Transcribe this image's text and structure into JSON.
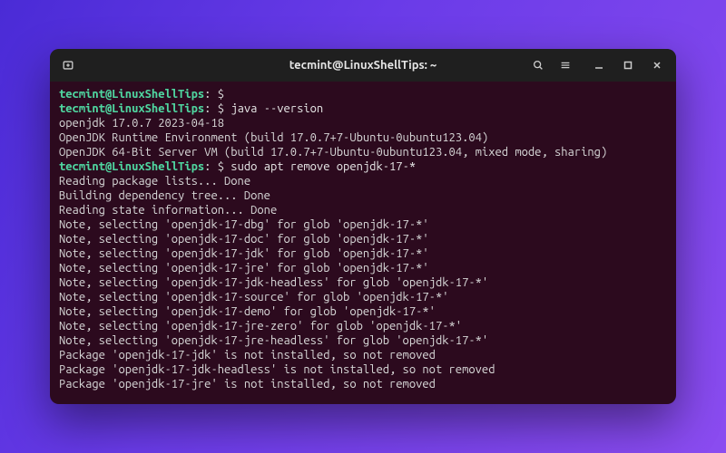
{
  "window": {
    "title": "tecmint@LinuxShellTips: ~"
  },
  "prompt": {
    "user_host": "tecmint@LinuxShellTips",
    "sep": ":",
    "path_sym": " $ "
  },
  "session": [
    {
      "type": "prompt",
      "cmd": ""
    },
    {
      "type": "prompt",
      "cmd": "java --version"
    },
    {
      "type": "out",
      "text": "openjdk 17.0.7 2023-04-18"
    },
    {
      "type": "out",
      "text": "OpenJDK Runtime Environment (build 17.0.7+7-Ubuntu-0ubuntu123.04)"
    },
    {
      "type": "out",
      "text": "OpenJDK 64-Bit Server VM (build 17.0.7+7-Ubuntu-0ubuntu123.04, mixed mode, sharing)"
    },
    {
      "type": "prompt",
      "cmd": "sudo apt remove openjdk-17-*"
    },
    {
      "type": "out",
      "text": "Reading package lists... Done"
    },
    {
      "type": "out",
      "text": "Building dependency tree... Done"
    },
    {
      "type": "out",
      "text": "Reading state information... Done"
    },
    {
      "type": "out",
      "text": "Note, selecting 'openjdk-17-dbg' for glob 'openjdk-17-*'"
    },
    {
      "type": "out",
      "text": "Note, selecting 'openjdk-17-doc' for glob 'openjdk-17-*'"
    },
    {
      "type": "out",
      "text": "Note, selecting 'openjdk-17-jdk' for glob 'openjdk-17-*'"
    },
    {
      "type": "out",
      "text": "Note, selecting 'openjdk-17-jre' for glob 'openjdk-17-*'"
    },
    {
      "type": "out",
      "text": "Note, selecting 'openjdk-17-jdk-headless' for glob 'openjdk-17-*'"
    },
    {
      "type": "out",
      "text": "Note, selecting 'openjdk-17-source' for glob 'openjdk-17-*'"
    },
    {
      "type": "out",
      "text": "Note, selecting 'openjdk-17-demo' for glob 'openjdk-17-*'"
    },
    {
      "type": "out",
      "text": "Note, selecting 'openjdk-17-jre-zero' for glob 'openjdk-17-*'"
    },
    {
      "type": "out",
      "text": "Note, selecting 'openjdk-17-jre-headless' for glob 'openjdk-17-*'"
    },
    {
      "type": "out",
      "text": "Package 'openjdk-17-jdk' is not installed, so not removed"
    },
    {
      "type": "out",
      "text": "Package 'openjdk-17-jdk-headless' is not installed, so not removed"
    },
    {
      "type": "out",
      "text": "Package 'openjdk-17-jre' is not installed, so not removed"
    }
  ],
  "icons": {
    "new_tab": "new-tab-icon",
    "search": "search-icon",
    "menu": "hamburger-icon",
    "minimize": "minimize-icon",
    "maximize": "maximize-icon",
    "close": "close-icon"
  }
}
